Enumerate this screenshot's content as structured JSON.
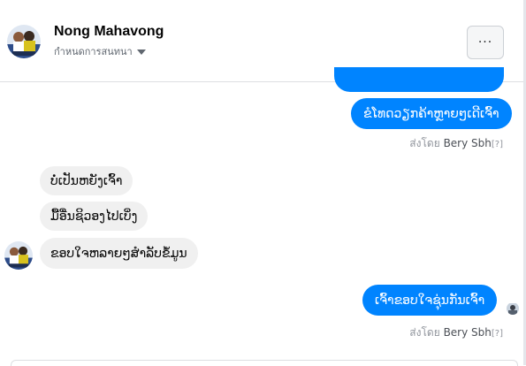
{
  "header": {
    "contact_name": "Nong Mahavong",
    "subtitle": "กำหนดการสนทนา",
    "more_label": "···"
  },
  "messages": {
    "outgoing_1": "ຂໍໂທດວຽກຄ້າຫຼາຍໆເດີເຈົ້າ",
    "incoming_1": "ບໍ່ເປັນຫຍັງເຈົ້າ",
    "incoming_2": "ມື້ອື່ນຊິວອງໄປເບິ່ງ",
    "incoming_3": "ຂອບໃຈຫລາຍໆສຳລັບຂໍ້ມູນ",
    "outgoing_2": "ເຈົ້າຂອບໃຈຊຸ່ນກັນເຈົ້າ"
  },
  "sent_by": {
    "prefix": "ส่งโดย",
    "sender": "Bery Sbh",
    "marker": "[?]"
  },
  "colors": {
    "outgoing_bubble": "#0084ff",
    "incoming_bubble": "#f0f0f0",
    "meta_text": "#90949c"
  },
  "icons": [
    "contact-avatar",
    "chevron-down-icon",
    "more-options-icon",
    "read-receipt-avatar"
  ]
}
